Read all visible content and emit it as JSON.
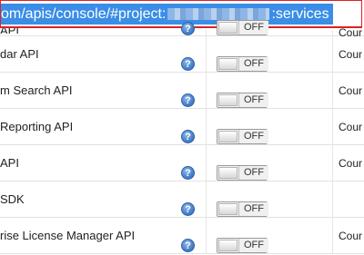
{
  "browser": {
    "url_prefix": "om/apis/console/#project:",
    "url_suffix": ":services"
  },
  "services": [
    {
      "name": "API",
      "toggle": "OFF",
      "quota": "Cour"
    },
    {
      "name": "dar API",
      "toggle": "OFF",
      "quota": "Cour"
    },
    {
      "name": "m Search API",
      "toggle": "OFF",
      "quota": "Cour"
    },
    {
      "name": "Reporting API",
      "toggle": "OFF",
      "quota": "Cour"
    },
    {
      "name": "API",
      "toggle": "OFF",
      "quota": "Cour"
    },
    {
      "name": "SDK",
      "toggle": "OFF",
      "quota": ""
    },
    {
      "name": "rise License Manager API",
      "toggle": "OFF",
      "quota": "Cour"
    }
  ],
  "help_icon_glyph": "?"
}
